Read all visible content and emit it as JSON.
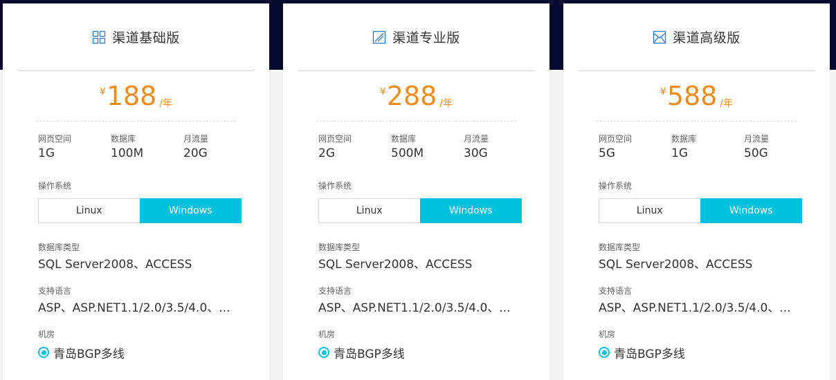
{
  "colors": {
    "accent": "#00c1de",
    "price": "#f28b1e",
    "header_band": "#050a2e",
    "icon": "#2d7fd9"
  },
  "plans": [
    {
      "icon": "grid-icon",
      "title": "渠道基础版",
      "currency": "¥",
      "price": "188",
      "unit": "/年",
      "specs": [
        {
          "label": "网页空间",
          "value": "1G"
        },
        {
          "label": "数据库",
          "value": "100M"
        },
        {
          "label": "月流量",
          "value": "20G"
        }
      ],
      "os_label": "操作系统",
      "os_options": [
        "Linux",
        "Windows"
      ],
      "os_selected": "Windows",
      "db_label": "数据库类型",
      "db_value": "SQL Server2008、ACCESS",
      "lang_label": "支持语言",
      "lang_value": "ASP、ASP.NET1.1/2.0/3.5/4.0、...",
      "room_label": "机房",
      "room_value": "青岛BGP多线"
    },
    {
      "icon": "edit-square-icon",
      "title": "渠道专业版",
      "currency": "¥",
      "price": "288",
      "unit": "/年",
      "specs": [
        {
          "label": "网页空间",
          "value": "2G"
        },
        {
          "label": "数据库",
          "value": "500M"
        },
        {
          "label": "月流量",
          "value": "30G"
        }
      ],
      "os_label": "操作系统",
      "os_options": [
        "Linux",
        "Windows"
      ],
      "os_selected": "Windows",
      "db_label": "数据库类型",
      "db_value": "SQL Server2008、ACCESS",
      "lang_label": "支持语言",
      "lang_value": "ASP、ASP.NET1.1/2.0/3.5/4.0、...",
      "room_label": "机房",
      "room_value": "青岛BGP多线"
    },
    {
      "icon": "envelope-box-icon",
      "title": "渠道高级版",
      "currency": "¥",
      "price": "588",
      "unit": "/年",
      "specs": [
        {
          "label": "网页空间",
          "value": "5G"
        },
        {
          "label": "数据库",
          "value": "1G"
        },
        {
          "label": "月流量",
          "value": "50G"
        }
      ],
      "os_label": "操作系统",
      "os_options": [
        "Linux",
        "Windows"
      ],
      "os_selected": "Windows",
      "db_label": "数据库类型",
      "db_value": "SQL Server2008、ACCESS",
      "lang_label": "支持语言",
      "lang_value": "ASP、ASP.NET1.1/2.0/3.5/4.0、...",
      "room_label": "机房",
      "room_value": "青岛BGP多线"
    }
  ]
}
